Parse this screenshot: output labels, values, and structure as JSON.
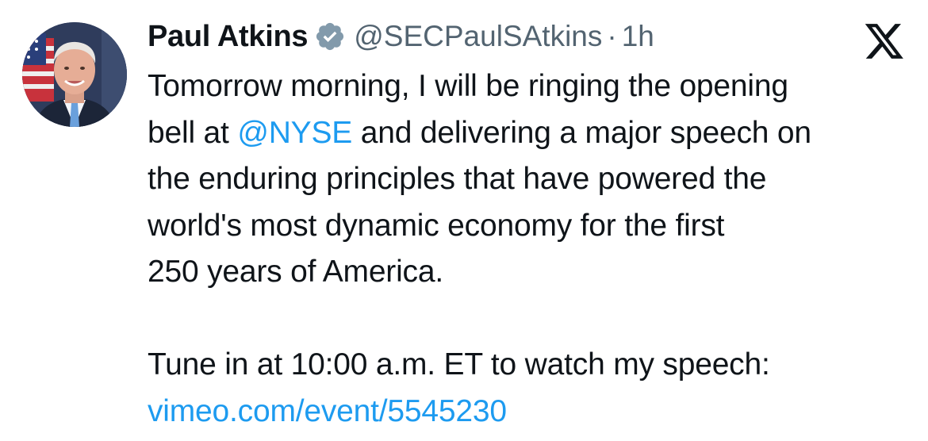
{
  "author": {
    "display_name": "Paul Atkins",
    "handle": "@SECPaulSAtkins",
    "separator": "·",
    "timestamp": "1h",
    "verified_icon": "verified-badge-icon",
    "avatar": "avatar-photo"
  },
  "platform": {
    "logo": "x-logo-icon"
  },
  "tweet": {
    "line1": "Tomorrow morning, I will be ringing the opening",
    "line2_before": "bell at ",
    "mention": "@NYSE",
    "line2_after": " and delivering a major speech on",
    "line3": "the enduring principles that have powered the",
    "line4": "world's most dynamic economy for the first",
    "line5": "250 years of America.",
    "line6": "Tune in at 10:00 a.m. ET to watch my speech:",
    "link": "vimeo.com/event/5545230"
  },
  "colors": {
    "link": "#1d9bf0",
    "text": "#0f1419",
    "secondary": "#536471",
    "verified_badge": "#829aab"
  }
}
